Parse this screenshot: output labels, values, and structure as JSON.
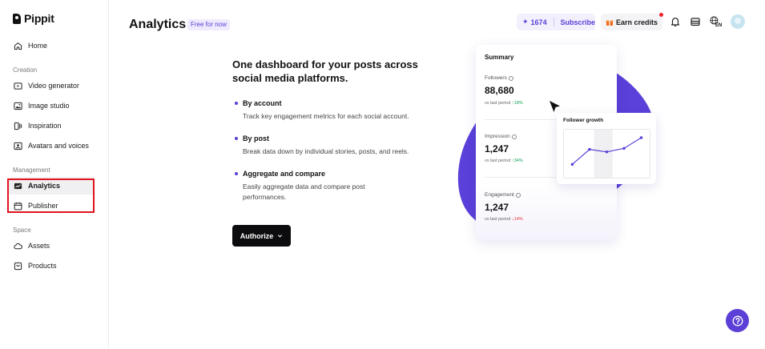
{
  "app": {
    "name": "Pippit"
  },
  "sidebar": {
    "home": "Home",
    "sections": {
      "creation": "Creation",
      "management": "Management",
      "space": "Space"
    },
    "creation_items": [
      "Video generator",
      "Image studio",
      "Inspiration",
      "Avatars and voices"
    ],
    "management_items": [
      "Analytics",
      "Publisher"
    ],
    "space_items": [
      "Assets",
      "Products"
    ],
    "active_item": "Analytics"
  },
  "header": {
    "title": "Analytics",
    "badge": "Free for now",
    "credits": "1674",
    "subscribe": "Subscribe",
    "earn_credits": "Earn credits",
    "lang": "EN"
  },
  "hero": {
    "title": "One dashboard for your posts across social media platforms.",
    "features": [
      {
        "title": "By account",
        "desc": "Track key engagement metrics for each social account."
      },
      {
        "title": "By post",
        "desc": "Break data down by individual stories, posts, and reels."
      },
      {
        "title": "Aggregate and compare",
        "desc": "Easily aggregate data and compare post performances."
      }
    ],
    "authorize": "Authorize"
  },
  "summary": {
    "title": "Summary",
    "vs_label": "vs last period",
    "metrics": [
      {
        "label": "Followers",
        "value": "88,680",
        "change": "↑18%",
        "direction": "up"
      },
      {
        "label": "Impression",
        "value": "1,247",
        "change": "↑34%",
        "direction": "up"
      },
      {
        "label": "Engagement",
        "value": "1,247",
        "change": "↓14%",
        "direction": "down"
      }
    ]
  },
  "growth": {
    "title": "Follower growth",
    "points": [
      0.2,
      0.62,
      0.55,
      0.65,
      0.95
    ]
  },
  "colors": {
    "accent": "#5b3fd6",
    "highlight": "#e0141e",
    "up": "#14a35a",
    "down": "#e0313a"
  }
}
